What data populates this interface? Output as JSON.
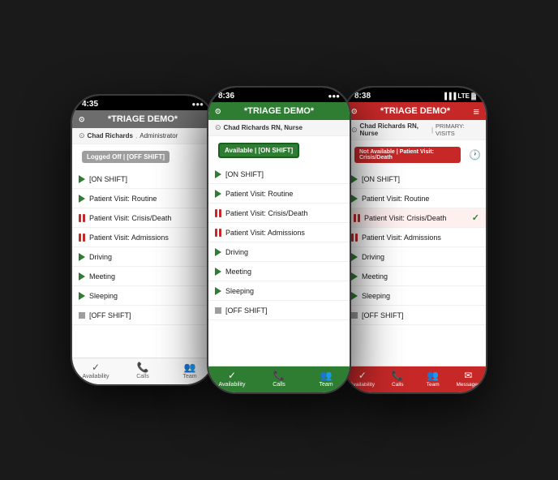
{
  "phones": [
    {
      "id": "left",
      "time": "4:35",
      "header": "*TRIAGE DEMO*",
      "header_color": "gray",
      "user_name": "Chad Richards",
      "user_role": "Administrator",
      "status_badge": "Logged Off | [OFF SHIFT]",
      "status_color": "gray",
      "menu_items": [
        {
          "type": "play",
          "label": "[ON SHIFT]"
        },
        {
          "type": "play",
          "label": "Patient Visit: Routine"
        },
        {
          "type": "pause",
          "label": "Patient Visit: Crisis/Death"
        },
        {
          "type": "pause",
          "label": "Patient Visit: Admissions"
        },
        {
          "type": "play",
          "label": "Driving"
        },
        {
          "type": "play",
          "label": "Meeting"
        },
        {
          "type": "play",
          "label": "Sleeping"
        },
        {
          "type": "off",
          "label": "[OFF SHIFT]"
        }
      ],
      "nav_items": [
        "Availability",
        "Calls",
        "Team"
      ],
      "nav_color": "gray",
      "active_nav": 0
    },
    {
      "id": "middle",
      "time": "8:36",
      "header": "*TRIAGE DEMO*",
      "header_color": "green",
      "user_name": "Chad Richards RN, Nurse",
      "user_role": "",
      "status_badge": "Available | [ON SHIFT]",
      "status_color": "green",
      "menu_items": [
        {
          "type": "play",
          "label": "[ON SHIFT]"
        },
        {
          "type": "play",
          "label": "Patient Visit: Routine"
        },
        {
          "type": "pause",
          "label": "Patient Visit: Crisis/Death"
        },
        {
          "type": "pause",
          "label": "Patient Visit: Admissions"
        },
        {
          "type": "play",
          "label": "Driving"
        },
        {
          "type": "play",
          "label": "Meeting"
        },
        {
          "type": "play",
          "label": "Sleeping"
        },
        {
          "type": "off",
          "label": "[OFF SHIFT]"
        }
      ],
      "nav_items": [
        "Availability",
        "Calls",
        "Team"
      ],
      "nav_color": "green",
      "active_nav": 0
    },
    {
      "id": "right",
      "time": "8:38",
      "header": "*TRIAGE DEMO*",
      "header_color": "red",
      "user_name": "Chad Richards RN, Nurse",
      "user_role": "PRIMARY: VISITS",
      "status_badge": "Not Available | Patient Visit: Crisis/Death",
      "status_color": "red",
      "menu_items": [
        {
          "type": "play",
          "label": "[ON SHIFT]"
        },
        {
          "type": "play",
          "label": "Patient Visit: Routine"
        },
        {
          "type": "pause",
          "label": "Patient Visit: Crisis/Death",
          "highlighted": true,
          "checked": true
        },
        {
          "type": "pause",
          "label": "Patient Visit: Admissions"
        },
        {
          "type": "play",
          "label": "Driving"
        },
        {
          "type": "play",
          "label": "Meeting"
        },
        {
          "type": "play",
          "label": "Sleeping"
        },
        {
          "type": "off",
          "label": "[OFF SHIFT]"
        }
      ],
      "nav_items": [
        "Availability",
        "Calls",
        "Team",
        "Messages"
      ],
      "nav_color": "red",
      "active_nav": 0
    }
  ],
  "icons": {
    "wifi": "⊙",
    "menu": "≡",
    "check": "✓",
    "clock": "🕐",
    "phone": "📞",
    "team": "👥",
    "mail": "✉",
    "availability": "✓"
  }
}
